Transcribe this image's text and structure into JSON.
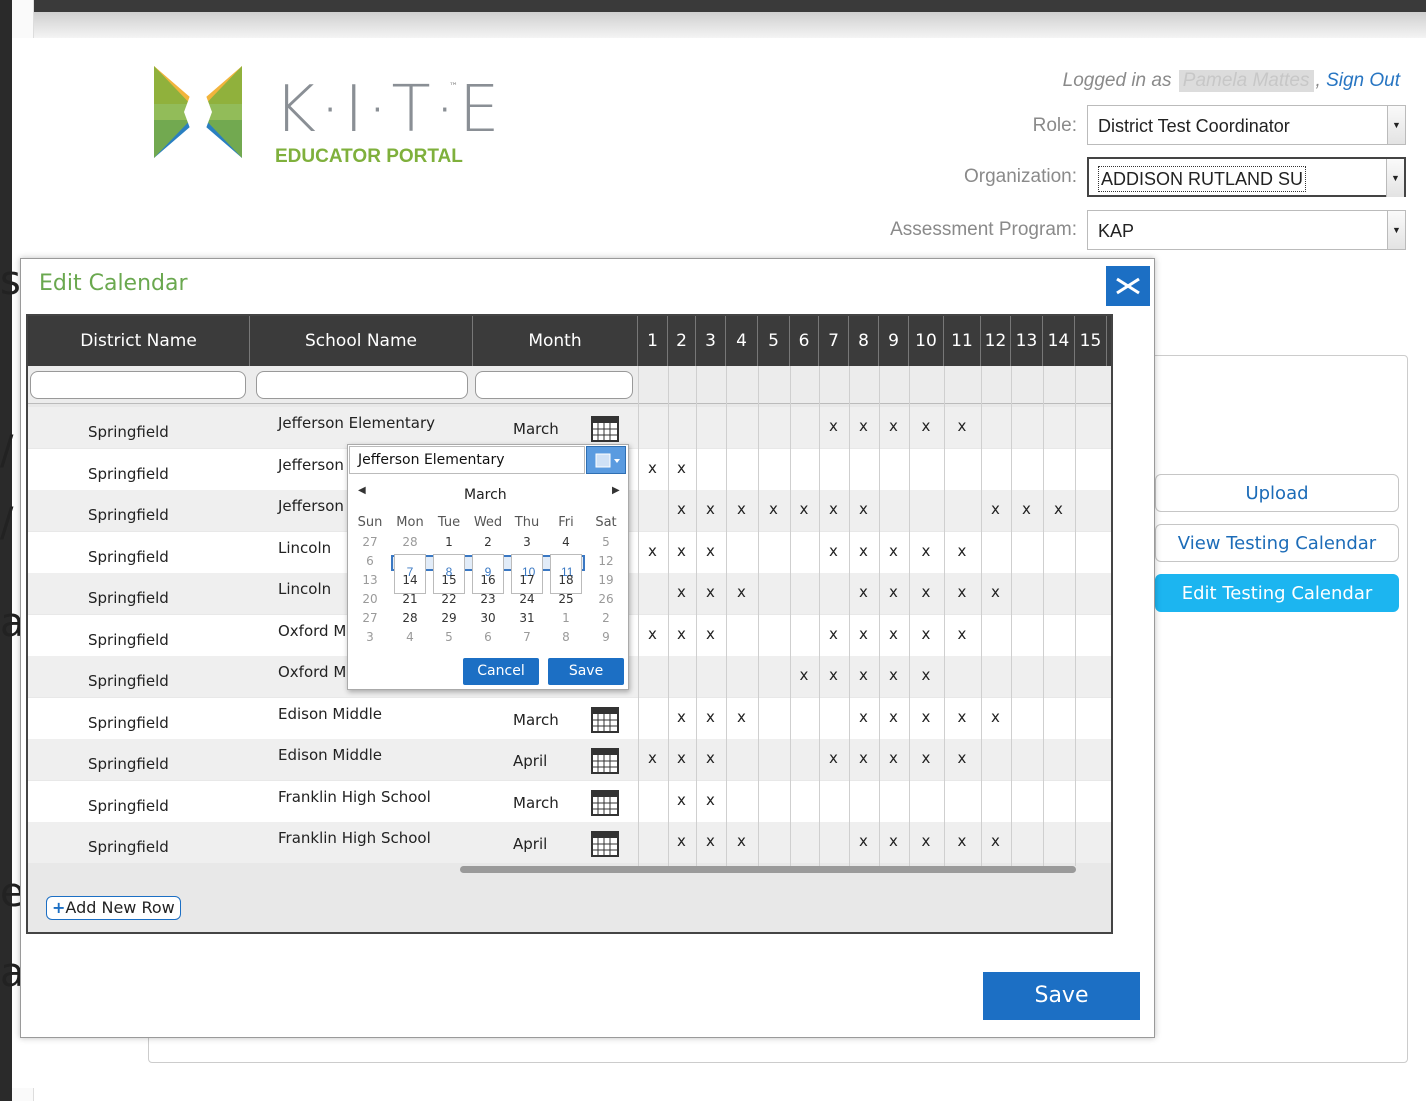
{
  "header": {
    "brand_word": "K·I·T·E",
    "brand_tm": "™",
    "brand_sub": "EDUCATOR PORTAL",
    "logged_in_prefix": "Logged in as",
    "user_name": "Pamela Mattes",
    "sign_out": "Sign Out",
    "role_label": "Role:",
    "role_value": "District Test Coordinator",
    "org_label": "Organization:",
    "org_value": "ADDISON RUTLAND SU",
    "program_label": "Assessment Program:",
    "program_value": "KAP"
  },
  "side_buttons": [
    "Upload",
    "View Testing Calendar",
    "Edit Testing Calendar"
  ],
  "modal": {
    "title": "Edit Calendar",
    "columns": [
      "District Name",
      "School Name",
      "Month"
    ],
    "day_headers": [
      "1",
      "2",
      "3",
      "4",
      "5",
      "6",
      "7",
      "8",
      "9",
      "10",
      "11",
      "12",
      "13",
      "14",
      "15"
    ],
    "rows": [
      {
        "district": "Springfield",
        "school": "Jefferson Elementary",
        "month": "March",
        "marks": [
          7,
          8,
          9,
          10,
          11
        ]
      },
      {
        "district": "Springfield",
        "school": "Jefferson",
        "month": "",
        "marks": [
          1,
          2
        ]
      },
      {
        "district": "Springfield",
        "school": "Jefferson",
        "month": "",
        "marks": [
          2,
          3,
          4,
          5,
          6,
          7,
          8,
          12,
          13,
          14
        ]
      },
      {
        "district": "Springfield",
        "school": "Lincoln",
        "month": "",
        "marks": [
          1,
          2,
          3,
          7,
          8,
          9,
          10,
          11
        ]
      },
      {
        "district": "Springfield",
        "school": "Lincoln",
        "month": "",
        "marks": [
          2,
          3,
          4,
          8,
          9,
          10,
          11,
          12
        ]
      },
      {
        "district": "Springfield",
        "school": "Oxford M",
        "month": "",
        "marks": [
          1,
          2,
          3,
          7,
          8,
          9,
          10,
          11
        ]
      },
      {
        "district": "Springfield",
        "school": "Oxford M",
        "month": "",
        "marks": [
          6,
          7,
          8,
          9,
          10
        ]
      },
      {
        "district": "Springfield",
        "school": "Edison Middle",
        "month": "March",
        "marks": [
          2,
          3,
          4,
          8,
          9,
          10,
          11,
          12
        ]
      },
      {
        "district": "Springfield",
        "school": "Edison Middle",
        "month": "April",
        "marks": [
          1,
          2,
          3,
          7,
          8,
          9,
          10,
          11
        ]
      },
      {
        "district": "Springfield",
        "school": "Franklin High School",
        "month": "March",
        "marks": [
          2,
          3
        ]
      },
      {
        "district": "Springfield",
        "school": "Franklin High School",
        "month": "April",
        "marks": [
          2,
          3,
          4,
          8,
          9,
          10,
          11,
          12
        ]
      }
    ],
    "x_char": "x",
    "add_row_label": "Add New Row",
    "add_row_plus": "+",
    "save_label": "Save"
  },
  "popup": {
    "school_value": "Jefferson Elementary",
    "month_label": "March",
    "weekdays": [
      "Sun",
      "Mon",
      "Tue",
      "Wed",
      "Thu",
      "Fri",
      "Sat"
    ],
    "weeks": [
      [
        "27",
        "28",
        "1",
        "2",
        "3",
        "4",
        "5"
      ],
      [
        "6",
        "7",
        "8",
        "9",
        "10",
        "11",
        "12"
      ],
      [
        "13",
        "14",
        "15",
        "16",
        "17",
        "18",
        "19"
      ],
      [
        "20",
        "21",
        "22",
        "23",
        "24",
        "25",
        "26"
      ],
      [
        "27",
        "28",
        "29",
        "30",
        "31",
        "1",
        "2"
      ],
      [
        "3",
        "4",
        "5",
        "6",
        "7",
        "8",
        "9"
      ]
    ],
    "cancel_label": "Cancel",
    "save_label": "Save"
  },
  "colors": {
    "accent_blue": "#1c6fc4",
    "active_tab": "#1cb5f0",
    "title_green": "#6aa84f",
    "header_dark": "#3b3b3b"
  }
}
